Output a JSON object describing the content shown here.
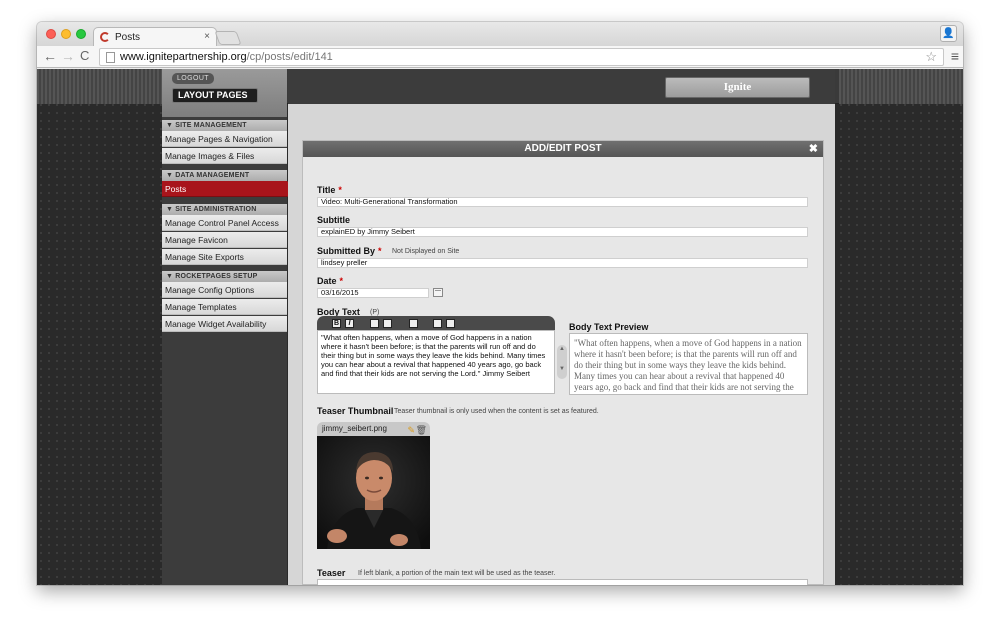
{
  "browser": {
    "tab_title": "Posts",
    "tab_close": "×",
    "url_host": "www.ignitepartnership.org",
    "url_path": "/cp/posts/edit/141",
    "back": "←",
    "forward": "→",
    "reload": "C",
    "star": "☆",
    "menu": "≡",
    "profile": "👤"
  },
  "sidebar": {
    "logout_label": "LOGOUT",
    "layout_pages_label": "LAYOUT PAGES",
    "sections": [
      {
        "title": "▼ SITE MANAGEMENT",
        "items": [
          "Manage Pages & Navigation",
          "Manage Images & Files"
        ]
      },
      {
        "title": "▼ DATA MANAGEMENT",
        "items": [
          "Posts"
        ]
      },
      {
        "title": "▼ SITE ADMINISTRATION",
        "items": [
          "Manage Control Panel Access",
          "Manage Favicon",
          "Manage Site Exports"
        ]
      },
      {
        "title": "▼ ROCKETPAGES SETUP",
        "items": [
          "Manage Config Options",
          "Manage Templates",
          "Manage Widget Availability"
        ]
      }
    ]
  },
  "header": {
    "site_button": "Ignite"
  },
  "panel": {
    "title": "ADD/EDIT POST",
    "close": "✖",
    "title_label": "Title",
    "title_value": "Video: Multi-Generational Transformation",
    "subtitle_label": "Subtitle",
    "subtitle_value": "explainED by Jimmy Seibert",
    "submitted_label": "Submitted By",
    "submitted_note": "Not Displayed on Site",
    "submitted_value": "lindsey preller",
    "date_label": "Date",
    "date_value": "03/16/2015",
    "required_mark": "*",
    "body_label": "Body Text",
    "body_note": "(P)",
    "body_text": "\"What often happens, when a move of God happens in a nation where it hasn't been before; is that the parents will run off and do their thing but in some ways they leave the kids behind.  Many times you can hear about a revival that happened 40 years ago, go back and find that their  kids are not serving the Lord.\" Jimmy Seibert",
    "preview_label": "Body Text Preview",
    "preview_text": "\"What often happens, when a move of God happens in a nation where it hasn't been before; is that the parents will run off and do their thing but in some ways they leave the kids behind. Many times you can hear about a revival that happened 40 years ago, go back and find that their kids are not serving the Lord.\" Jimmy Seibert",
    "thumb_label": "Teaser Thumbnail",
    "thumb_note": "Teaser thumbnail is only used when the content is set as featured.",
    "thumb_filename": "jimmy_seibert.png",
    "teaser_label": "Teaser",
    "teaser_note": "If left blank, a portion of the main text will be used as the teaser.",
    "teaser_value": ""
  },
  "editor_toolbar": {
    "bold": "B",
    "italic": "I",
    "scroll_up": "▲",
    "scroll_down": "▼"
  },
  "colors": {
    "accent_red": "#a8141b"
  }
}
